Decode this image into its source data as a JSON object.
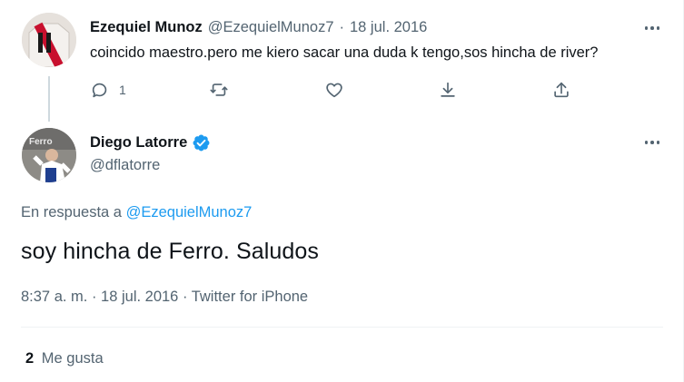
{
  "reply_tweet": {
    "display_name": "Ezequiel Munoz",
    "handle": "@EzequielMunoz7",
    "separator": "·",
    "date": "18 jul. 2016",
    "text": "coincido maestro.pero me kiero sacar una duda k tengo,sos hincha de river?",
    "reply_count": "1",
    "icons": [
      "reply-icon",
      "retweet-icon",
      "like-icon",
      "bookmark-icon",
      "share-icon"
    ]
  },
  "main_tweet": {
    "display_name": "Diego Latorre",
    "handle": "@dflatorre",
    "verified": true,
    "in_reply_prefix": "En respuesta a",
    "in_reply_mention": "@EzequielMunoz7",
    "text": "soy hincha de Ferro. Saludos",
    "timestamp": "8:37 a. m. · 18 jul. 2016 · Twitter for iPhone",
    "likes_count": "2",
    "likes_label": "Me gusta"
  },
  "colors": {
    "accent": "#1d9bf0",
    "text_primary": "#0f1419",
    "text_secondary": "#536471",
    "divider": "#eff3f4",
    "thread_line": "#cfd9de"
  }
}
